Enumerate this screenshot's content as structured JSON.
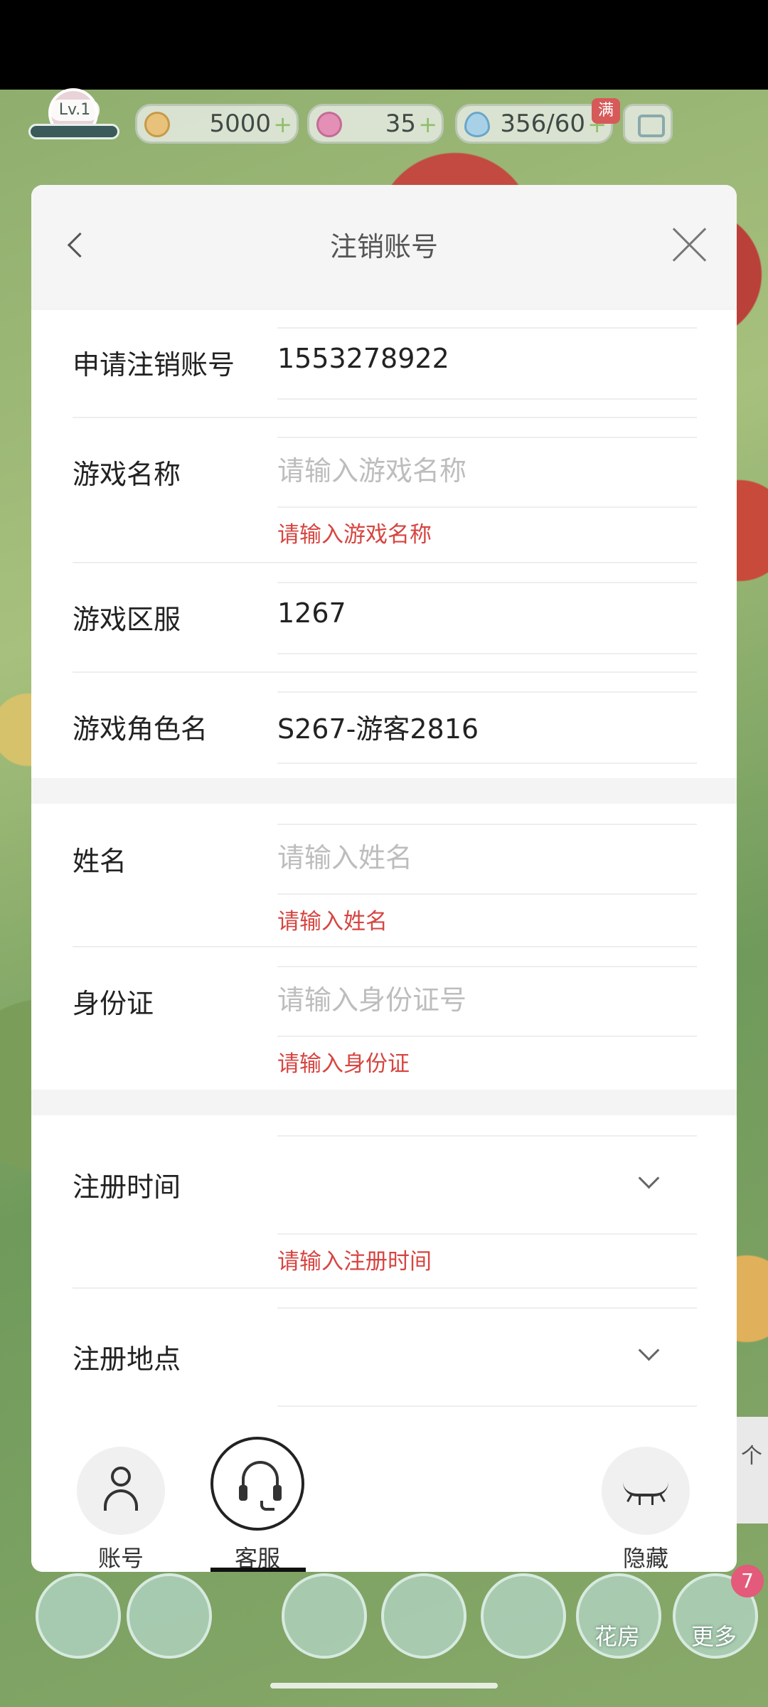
{
  "hud": {
    "level": "Lv.1",
    "coins": "5000",
    "stars": "35",
    "water": "356/60",
    "water_full_badge": "满",
    "icons": [
      "coin-icon",
      "star-icon",
      "water-drop-icon",
      "camera-icon"
    ]
  },
  "modal": {
    "title": "注销账号",
    "fields": {
      "account_label": "申请注销账号",
      "account_value": "1553278922",
      "game_name_label": "游戏名称",
      "game_name_placeholder": "请输入游戏名称",
      "game_name_error": "请输入游戏名称",
      "server_label": "游戏区服",
      "server_value": "1267",
      "role_label": "游戏角色名",
      "role_value": "S267-游客2816",
      "name_label": "姓名",
      "name_placeholder": "请输入姓名",
      "name_error": "请输入姓名",
      "id_label": "身份证",
      "id_placeholder": "请输入身份证号",
      "id_error": "请输入身份证",
      "reg_time_label": "注册时间",
      "reg_time_error": "请输入注册时间",
      "reg_place_label": "注册地点"
    }
  },
  "bottom_nav": {
    "account": "账号",
    "service": "客服",
    "hide": "隐藏"
  },
  "side_tab": "个",
  "game_buttons": {
    "flower_house": "花房",
    "more": "更多",
    "more_badge": "7"
  },
  "colors": {
    "error": "#d64541",
    "placeholder": "#bdbdbd",
    "background": "#f4f4f4"
  }
}
